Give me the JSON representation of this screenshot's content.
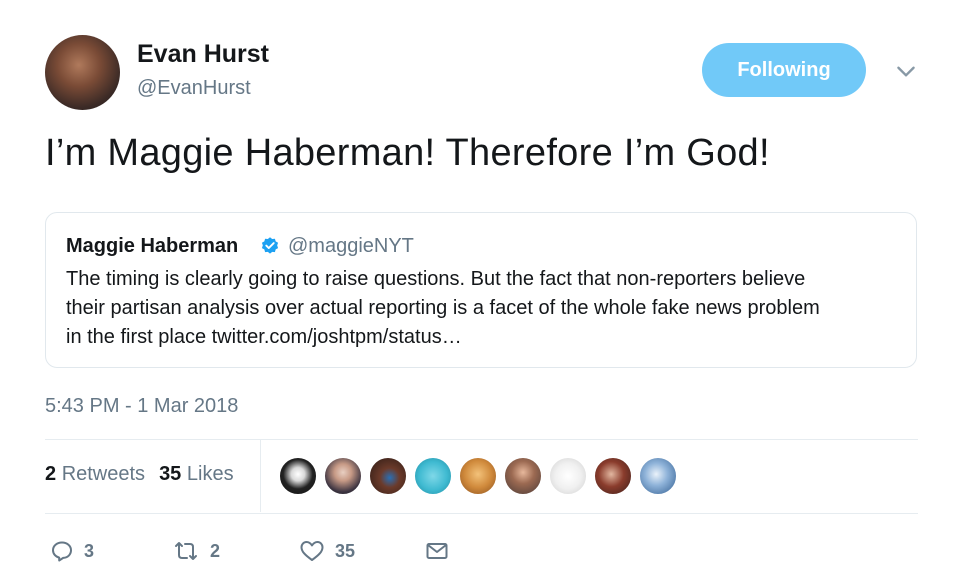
{
  "author": {
    "name": "Evan Hurst",
    "handle": "@EvanHurst"
  },
  "follow_button": {
    "label": "Following",
    "color": "#71c9f8"
  },
  "tweet": {
    "text": "I’m Maggie Haberman! Therefore I’m God!",
    "timestamp": "5:43 PM - 1 Mar 2018"
  },
  "quoted": {
    "name": "Maggie Haberman",
    "verified_icon": "verified-badge-icon",
    "handle": "@maggieNYT",
    "lines": [
      "The timing is clearly going to raise questions. But the fact that non-reporters believe",
      "their partisan analysis over actual reporting is a facet of the whole fake news problem",
      "in the first place twitter.com/joshtpm/status…"
    ]
  },
  "stats": {
    "retweets_count": "2",
    "retweets_label": "Retweets",
    "likes_count": "35",
    "likes_label": "Likes",
    "likers_shown": 9
  },
  "actions": {
    "reply_count": "3",
    "retweet_count": "2",
    "like_count": "35"
  },
  "colors": {
    "accent": "#71c9f8",
    "text": "#14171a",
    "muted": "#657786",
    "border": "#e1e8ed"
  }
}
